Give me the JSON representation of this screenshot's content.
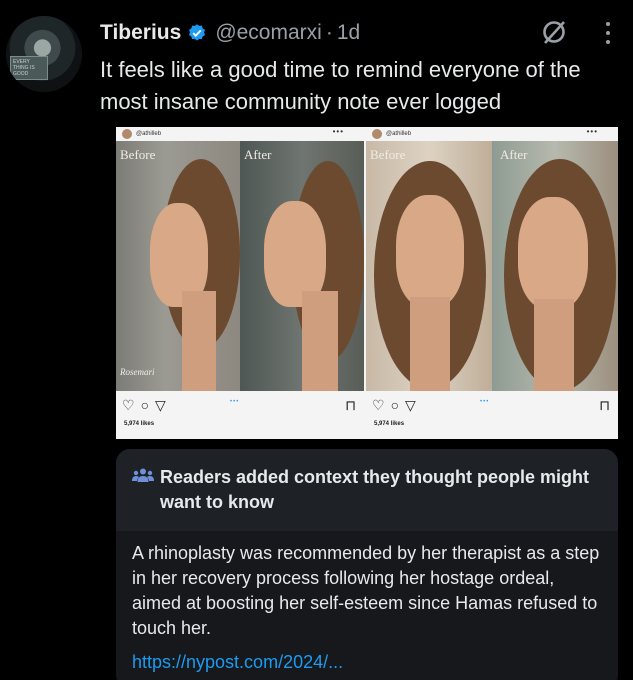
{
  "tweet": {
    "author_name": "Tiberius",
    "handle": "@ecomarxi",
    "separator": "·",
    "time": "1d",
    "text": "It feels like a good time to remind everyone of the most insane community note ever logged",
    "avatar_sign_text": "EVERY THING IS GOOD"
  },
  "media": {
    "left_post": {
      "username": "@athilleb",
      "label_before": "Before",
      "label_after": "After",
      "likes": "5,974 likes",
      "watermark": "Rosemari"
    },
    "right_post": {
      "username": "@athilleb",
      "label_before": "Before",
      "label_after": "After",
      "likes": "5,974 likes"
    }
  },
  "note": {
    "title": "Readers added context they thought people might want to know",
    "body": "A rhinoplasty was recommended by her therapist as a step in her recovery process following her hostage ordeal, aimed at boosting her self-esteem since Hamas refused to touch her.",
    "link": "https://nypost.com/2024/..."
  },
  "colors": {
    "background": "#000000",
    "verified": "#1d9bf0",
    "link": "#1d9bf0",
    "note_bg": "#16181c"
  },
  "icons": [
    "verified-badge-icon",
    "grok-icon",
    "more-icon",
    "community-note-icon",
    "heart-icon",
    "comment-icon",
    "share-icon",
    "bookmark-icon"
  ]
}
